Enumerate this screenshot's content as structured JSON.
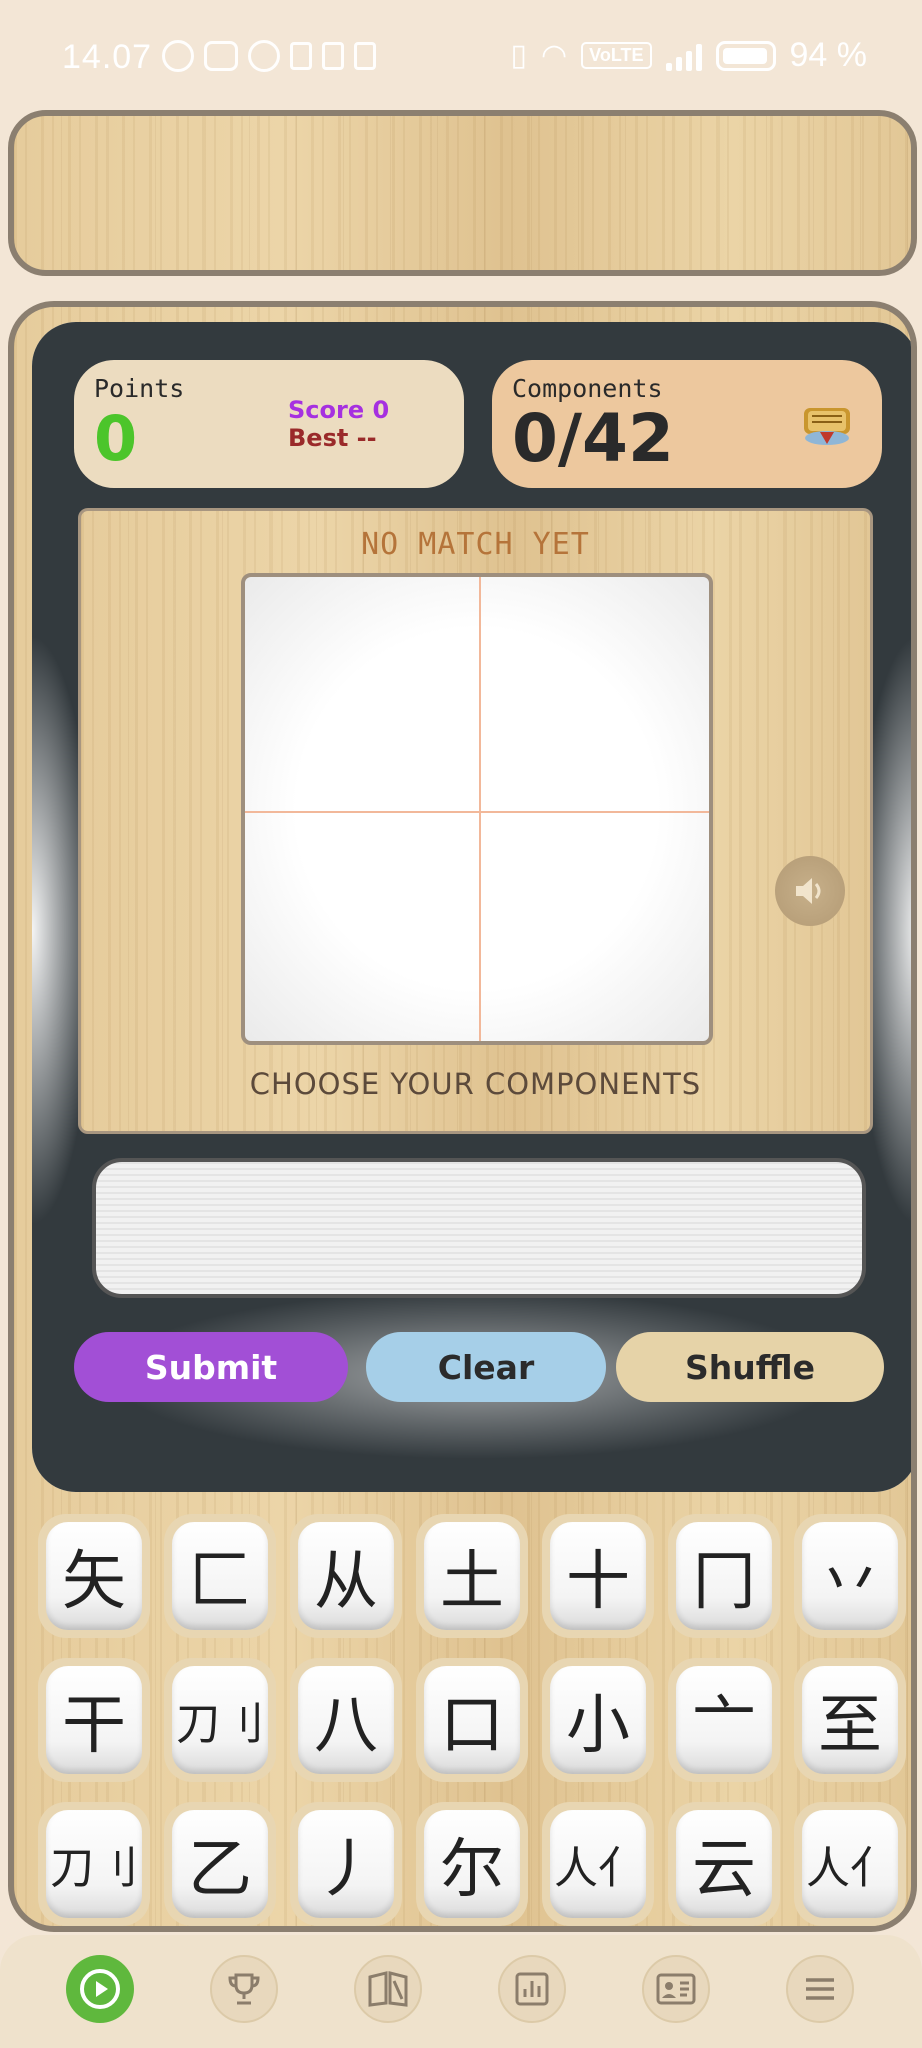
{
  "status_bar": {
    "time": "14.07",
    "battery": "94 %",
    "network": "VoLTE"
  },
  "stats": {
    "points_label": "Points",
    "points_value": "0",
    "score": "Score 0",
    "best": "Best --",
    "components_label": "Components",
    "components_value": "0/42"
  },
  "canvas": {
    "status": "NO MATCH YET",
    "prompt": "CHOOSE YOUR COMPONENTS"
  },
  "actions": {
    "submit": "Submit",
    "clear": "Clear",
    "shuffle": "Shuffle"
  },
  "tiles": [
    [
      "矢",
      "匚",
      "从",
      "土",
      "十",
      "冂",
      "丷"
    ],
    [
      "干",
      "刀刂",
      "八",
      "口",
      "小",
      "亠",
      "至"
    ],
    [
      "刀刂",
      "乙",
      "丿",
      "尔",
      "人亻",
      "云",
      "人亻"
    ]
  ],
  "nav": [
    "play-icon",
    "trophy-icon",
    "book-icon",
    "chart-icon",
    "profile-card-icon",
    "menu-icon"
  ],
  "colors": {
    "points_green": "#4cc52b",
    "score_purple": "#a630e0",
    "best_red": "#9a2a2a",
    "submit_purple": "#a24fd6",
    "clear_blue": "#a6cfe8",
    "shuffle_tan": "#e6d3a8",
    "active_nav_green": "#5fb83d"
  }
}
